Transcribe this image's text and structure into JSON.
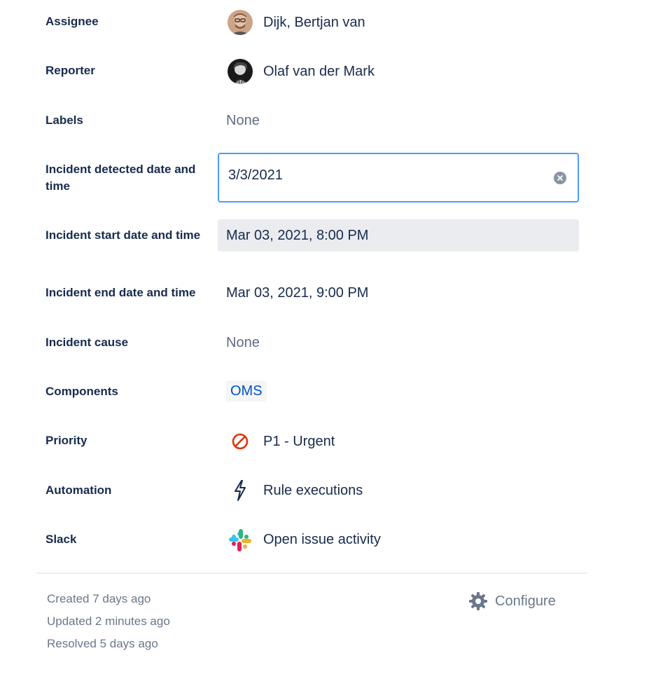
{
  "fields": {
    "assignee": {
      "label": "Assignee",
      "value": "Dijk, Bertjan van"
    },
    "reporter": {
      "label": "Reporter",
      "value": "Olaf van der Mark"
    },
    "labels": {
      "label": "Labels",
      "value": "None"
    },
    "incident_detected": {
      "label": "Incident detected date and time",
      "value": "3/3/2021"
    },
    "incident_start": {
      "label": "Incident start date and time",
      "value": "Mar 03, 2021, 8:00 PM"
    },
    "incident_end": {
      "label": "Incident end date and time",
      "value": "Mar 03, 2021, 9:00 PM"
    },
    "incident_cause": {
      "label": "Incident cause",
      "value": "None"
    },
    "components": {
      "label": "Components",
      "value": "OMS"
    },
    "priority": {
      "label": "Priority",
      "value": "P1 - Urgent",
      "icon": "blocker-icon",
      "color": "#de350b"
    },
    "automation": {
      "label": "Automation",
      "value": "Rule executions",
      "icon": "lightning-icon"
    },
    "slack": {
      "label": "Slack",
      "value": "Open issue activity",
      "icon": "slack-icon"
    }
  },
  "footer": {
    "created": "Created 7 days ago",
    "updated": "Updated 2 minutes ago",
    "resolved": "Resolved 5 days ago",
    "configure_label": "Configure"
  },
  "colors": {
    "focus_border": "#4c9aff",
    "link": "#0052cc",
    "muted": "#5e6c84"
  }
}
